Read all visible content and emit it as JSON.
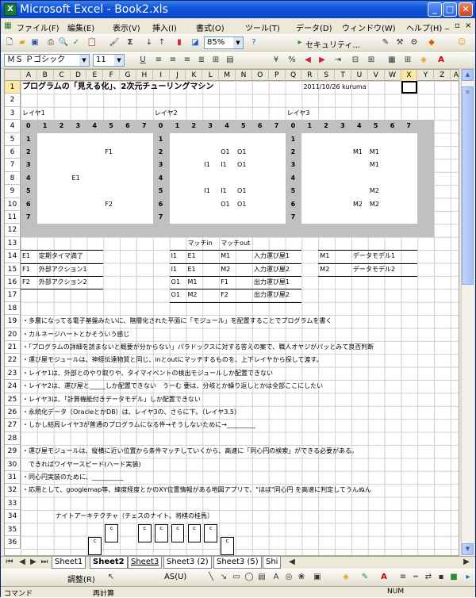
{
  "window": {
    "title": "Microsoft Excel - Book2.xls",
    "min": "_",
    "max": "□",
    "close": "✕",
    "icon": "X"
  },
  "menu": [
    {
      "label": "ファイル(F)"
    },
    {
      "label": "編集(E)"
    },
    {
      "label": "表示(V)"
    },
    {
      "label": "挿入(I)"
    },
    {
      "label": "書式(O)"
    },
    {
      "label": "ツール(T)"
    },
    {
      "label": "データ(D)"
    },
    {
      "label": "ウィンドウ(W)"
    },
    {
      "label": "ヘルプ(H)"
    }
  ],
  "toolbar": {
    "zoom": "85%",
    "security": "セキュリティ...",
    "sigma": "Σ"
  },
  "format": {
    "font": "ＭＳ Ｐゴシック",
    "size": "11",
    "underline": "U"
  },
  "columns": [
    "A",
    "B",
    "C",
    "D",
    "E",
    "F",
    "G",
    "H",
    "I",
    "J",
    "K",
    "L",
    "M",
    "N",
    "O",
    "P",
    "Q",
    "R",
    "S",
    "T",
    "U",
    "V",
    "W",
    "X",
    "Y",
    "Z",
    "AA"
  ],
  "rows": [
    "1",
    "2",
    "3",
    "4",
    "5",
    "6",
    "7",
    "8",
    "9",
    "10",
    "11",
    "12",
    "13",
    "14",
    "15",
    "16",
    "17",
    "18",
    "19",
    "20",
    "21",
    "22",
    "23",
    "24",
    "25",
    "26",
    "27",
    "28",
    "29",
    "30",
    "31",
    "32",
    "33",
    "34",
    "35",
    "36"
  ],
  "cells": {
    "title": "プログラムの「見える化」、2次元チューリングマシン",
    "date": "2011/10/26 kuruma",
    "layer1": "レイヤ1",
    "layer2": "レイヤ2",
    "layer3": "レイヤ3",
    "l1_f1": "F1",
    "l1_e1": "E1",
    "l1_f2": "F2",
    "l2_o1a": "O1",
    "l2_o1b": "O1",
    "l2_i1a": "I1",
    "l2_i1b": "I1",
    "l2_o1c": "O1",
    "l2_i1c": "I1",
    "l2_i1d": "I1",
    "l2_o1d": "O1",
    "l2_o1e": "O1",
    "l2_o1f": "O1",
    "l3_m1a": "M1",
    "l3_m1b": "M1",
    "l3_m1c": "M1",
    "l3_m2a": "M2",
    "l3_m2b": "M2",
    "l3_m2c": "M2",
    "match_in": "マッチin",
    "match_out": "マッチout",
    "e1": "E1",
    "e1_desc": "定期タイマ満了",
    "f1": "F1",
    "f1_desc": "外部アクション1",
    "f2": "F2",
    "f2_desc": "外部アクション2",
    "r14c1": "I1",
    "r14c2": "E1",
    "r14c3": "M1",
    "r14c4": "入力運び屋1",
    "r15c1": "I1",
    "r15c2": "E1",
    "r15c3": "M2",
    "r15c4": "入力運び屋2",
    "r16c1": "O1",
    "r16c2": "M1",
    "r16c3": "F1",
    "r16c4": "出力運び屋1",
    "r17c1": "O1",
    "r17c2": "M2",
    "r17c3": "F2",
    "r17c4": "出力運び屋2",
    "m1": "M1",
    "m1_desc": "データモデル1",
    "m2": "M2",
    "m2_desc": "データモデル2",
    "n19": "・多層になってる電子基盤みたいに、階層化された平面に「モジュール」を配置することでプログラムを書く",
    "n20": "・カルネージハートとかそういう感じ",
    "n21": "・「プログラムの詳細を読まないと概要が分からない」パラドックスに対する答えの案で、職人オヤジがパッとみて良否判断",
    "n22": "・運び屋モジュールは、神経伝達物質と同じ、inとoutにマッチするものを、上下レイヤから探して渡す。",
    "n23": "・レイヤ1は、外部とのやり取りや、タイマイベントの検出モジュールしか配置できない",
    "n24": "・レイヤ2は、運び屋と_____しか配置できない　うーむ 要は、分岐とか繰り返しとかは全部ここにしたい",
    "n25": "・レイヤ3は、「計算機能付きデータモデル」しか配置できない",
    "n26": "・永続化データ（OracleとかDB）は、レイヤ3の、さらに下。（レイヤ3.5）",
    "n27": "・しかし結局レイヤ3が普通のプログラムになる件→そうしないために→_________",
    "n29": "・運び屋モジュールは、縦横に近い位置から条件マッチしていくから、高速に「同心円の検索」ができる必要がある。",
    "n30": "　できればワイヤースピード(ハード実装)",
    "n31": "・同心円実装のために、__________",
    "n32": "・応用として、googlemap等、緯度経度とかのXY位置情報がある地図アプリで、\"ほぼ\"同心円 を高速に判定してうんぬん",
    "n34": "ナイトアーキテクチャ（チェスのナイト、将棋の桂馬）",
    "c": "c"
  },
  "tabs": [
    {
      "label": "Sheet1"
    },
    {
      "label": "Sheet2"
    },
    {
      "label": "Sheet3"
    },
    {
      "label": "Sheet3 (2)"
    },
    {
      "label": "Sheet3 (5)"
    },
    {
      "label": "Shi"
    }
  ],
  "draw": {
    "adjust": "調整(R)",
    "autoshape": "AS(U)"
  },
  "status": {
    "left": "コマンド",
    "mid": "再計算",
    "num": "NUM"
  }
}
